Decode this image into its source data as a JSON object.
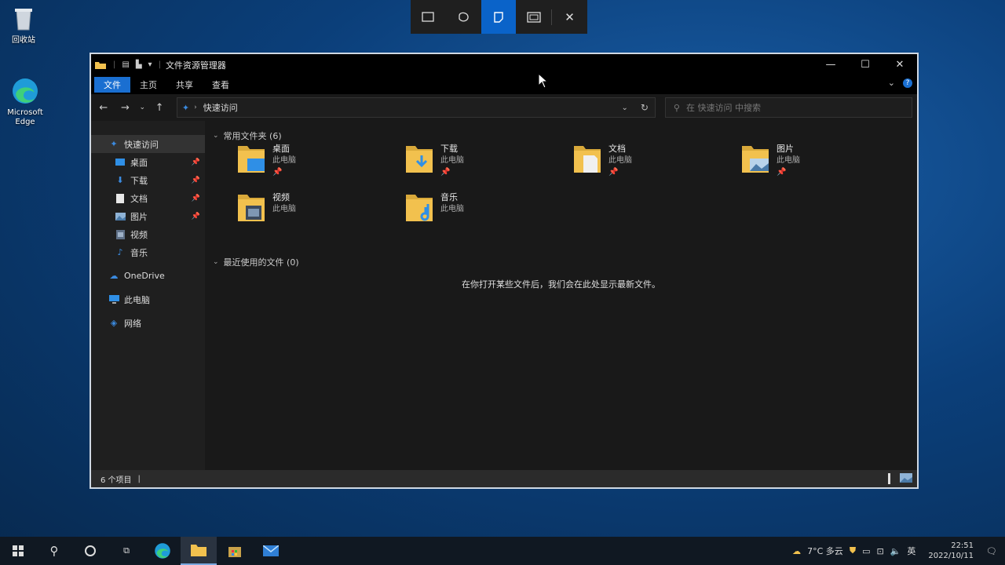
{
  "desktop": {
    "icons": [
      {
        "label": "回收站",
        "icon": "recycle-bin-icon"
      },
      {
        "label": "Microsoft Edge",
        "icon": "edge-icon"
      }
    ]
  },
  "snip_toolbar": {
    "buttons": [
      {
        "icon": "rectangle-snip-icon"
      },
      {
        "icon": "freeform-snip-icon"
      },
      {
        "icon": "window-snip-icon",
        "active": true
      },
      {
        "icon": "fullscreen-snip-icon"
      },
      {
        "icon": "close-icon"
      }
    ]
  },
  "explorer": {
    "title": "文件资源管理器",
    "ribbon_tabs": [
      "文件",
      "主页",
      "共享",
      "查看"
    ],
    "address": {
      "breadcrumb": "快速访问",
      "search_placeholder": "在 快速访问 中搜索"
    },
    "nav": {
      "quick_access": "快速访问",
      "pinned": [
        {
          "label": "桌面",
          "icon": "desktop-folder-icon"
        },
        {
          "label": "下载",
          "icon": "download-folder-icon"
        },
        {
          "label": "文档",
          "icon": "documents-folder-icon"
        },
        {
          "label": "图片",
          "icon": "pictures-folder-icon"
        },
        {
          "label": "视频",
          "icon": "videos-folder-icon"
        },
        {
          "label": "音乐",
          "icon": "music-folder-icon"
        }
      ],
      "onedrive": "OneDrive",
      "this_pc": "此电脑",
      "network": "网络"
    },
    "frequent_folders": {
      "header": "常用文件夹 (6)",
      "items": [
        {
          "name": "桌面",
          "sub": "此电脑"
        },
        {
          "name": "下载",
          "sub": "此电脑"
        },
        {
          "name": "文档",
          "sub": "此电脑"
        },
        {
          "name": "图片",
          "sub": "此电脑"
        },
        {
          "name": "视频",
          "sub": "此电脑"
        },
        {
          "name": "音乐",
          "sub": "此电脑"
        }
      ]
    },
    "recent_files": {
      "header": "最近使用的文件 (0)",
      "empty_message": "在你打开某些文件后，我们会在此处显示最新文件。"
    },
    "status": {
      "item_count": "6 个项目"
    }
  },
  "taskbar": {
    "weather": "7°C 多云",
    "ime": "英",
    "time": "22:51",
    "date": "2022/10/11"
  },
  "colors": {
    "accent": "#1a6fd1",
    "folder": "#f2c14e"
  }
}
